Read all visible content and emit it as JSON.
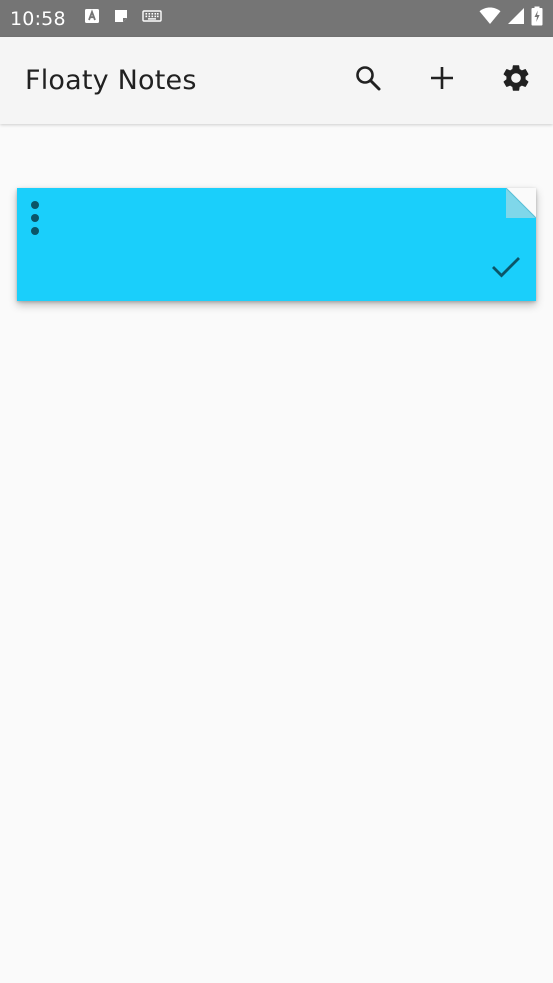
{
  "status_bar": {
    "time": "10:58",
    "icons": [
      "text-a-icon",
      "note-icon",
      "keyboard-icon",
      "wifi-icon",
      "signal-icon",
      "battery-charging-icon"
    ]
  },
  "app_bar": {
    "title": "Floaty Notes",
    "actions": [
      "search-icon",
      "add-icon",
      "settings-icon"
    ]
  },
  "notes": [
    {
      "text": "",
      "color": "#1acffb",
      "icons": [
        "more-vert-icon",
        "check-icon"
      ]
    }
  ],
  "colors": {
    "status_bar": "#757575",
    "app_bar": "#f5f5f5",
    "background": "#fafafa",
    "note": "#1acffb",
    "note_icon": "#0b5568"
  }
}
